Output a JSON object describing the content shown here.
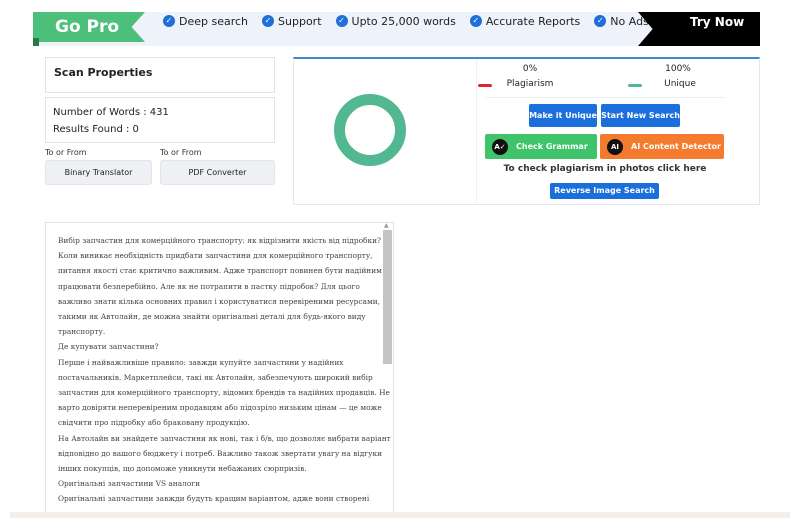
{
  "banner": {
    "gopro": "Go Pro",
    "features": [
      "Deep search",
      "Support",
      "Upto 25,000 words",
      "Accurate Reports",
      "No Ads"
    ],
    "try_now": "Try Now"
  },
  "scan": {
    "title": "Scan Properties",
    "words": "Number of Words : 431",
    "results": "Results Found : 0"
  },
  "tools": [
    {
      "label": "To or From",
      "button": "Binary Translator"
    },
    {
      "label": "To or From",
      "button": "PDF Converter"
    }
  ],
  "result": {
    "plagiarism_pct": "0%",
    "plagiarism_label": "Plagiarism",
    "unique_pct": "100%",
    "unique_label": "Unique",
    "plagiarism_value": 0,
    "unique_value": 100,
    "colors": {
      "plagiarism": "#e0262e",
      "unique": "#52b891"
    }
  },
  "actions": {
    "make_unique": "Make it Unique",
    "new_search": "Start New Search",
    "grammar": "Check Grammar",
    "ai_detector": "AI Content Detector",
    "photo_hint": "To check plagiarism in photos click here",
    "reverse_image": "Reverse Image Search"
  },
  "text_lines": [
    "Вибір запчастин для комерційного транспорту: як відрізнити якість від підробки?",
    "Коли виникає необхідність придбати запчастини для комерційного транспорту,",
    "питання якості стає критично важливим. Адже транспорт повинен бути надійним і",
    "працювати безперебійно. Але як не потрапити в пастку підробок? Для цього",
    "важливо знати кілька основних правил і користуватися перевіреними ресурсами,",
    "такими як Автолайн, де можна знайти оригінальні деталі для будь-якого виду",
    "транспорту.",
    "Де купувати запчастини?",
    "Перше і найважливіше правило: завжди купуйте запчастини у надійних",
    "постачальників. Маркетплейси, такі як Автолайн, забезпечують широкий вибір",
    "запчастин для комерційного транспорту, відомих брендів та надійних продавців. Не",
    "варто довіряти неперевіреним продавцям або підозріло низьким цінам — це може",
    "свідчити про підробку або браковану продукцію.",
    "На Автолайн ви знайдете запчастини як нові, так і б/в, що дозволяє вибрати варіант",
    "відповідно до вашого бюджету і потреб. Важливо також звертати увагу на відгуки",
    "інших покупців, що допоможе уникнути небажаних сюрпризів.",
    "Оригінальні запчастини VS аналоги",
    "Оригінальні запчастини завжди будуть кращим варіантом, адже вони створені"
  ]
}
